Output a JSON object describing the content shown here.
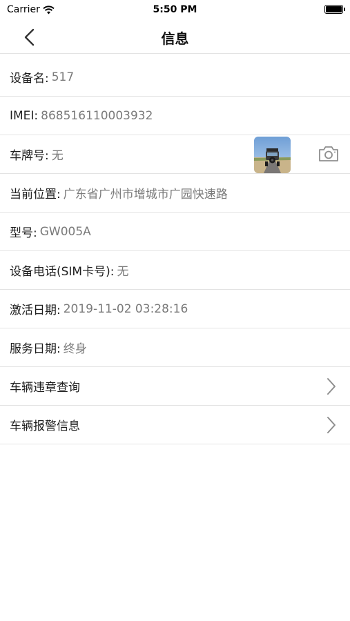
{
  "status_bar": {
    "carrier": "Carrier",
    "time": "5:50 PM"
  },
  "nav": {
    "title": "信息"
  },
  "rows": [
    {
      "label": "设备名:",
      "value": "517"
    },
    {
      "label": "IMEI:",
      "value": "868516110003932"
    },
    {
      "label": "车牌号:",
      "value": "无"
    },
    {
      "label": "当前位置:",
      "value": "广东省广州市增城市广园快速路"
    },
    {
      "label": "型号:",
      "value": "GW005A"
    },
    {
      "label": "设备电话(SIM卡号):",
      "value": "无"
    },
    {
      "label": "激活日期:",
      "value": "2019-11-02 03:28:16"
    },
    {
      "label": "服务日期:",
      "value": "终身"
    }
  ],
  "nav_rows": [
    {
      "label": "车辆违章查询"
    },
    {
      "label": "车辆报警信息"
    }
  ],
  "colors": {
    "label": "#1e1e1e",
    "value": "#7a7a7a",
    "divider": "#e3e3e3",
    "icon": "#8e8e8e"
  }
}
